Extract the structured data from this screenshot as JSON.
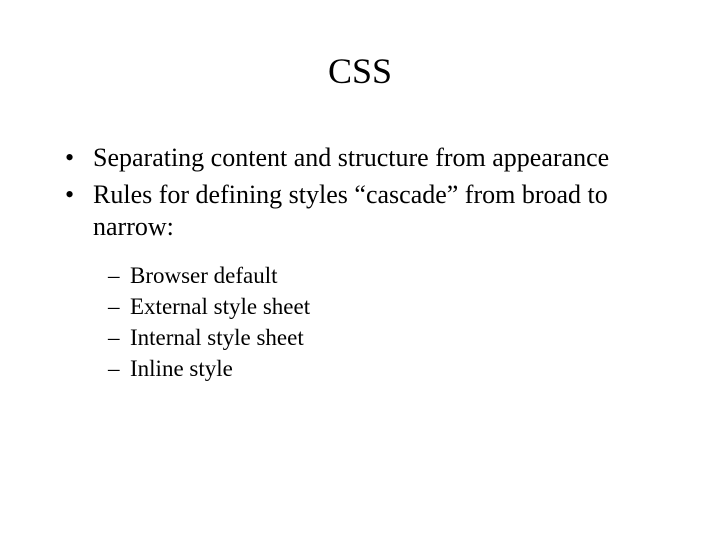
{
  "title": "CSS",
  "bullets": [
    "Separating content and structure from appearance",
    "Rules for defining styles “cascade” from broad to narrow:"
  ],
  "subbullets": [
    "Browser default",
    "External style sheet",
    "Internal style sheet",
    "Inline style"
  ]
}
